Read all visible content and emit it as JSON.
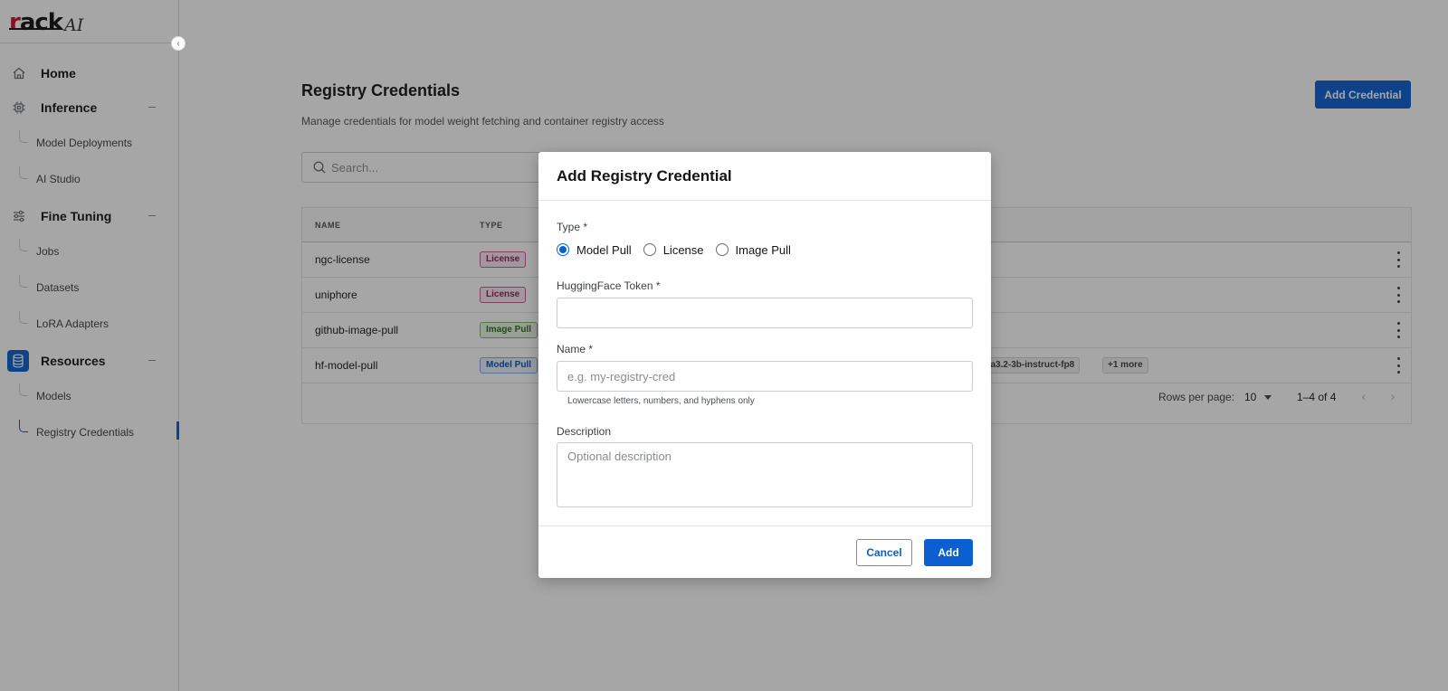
{
  "app": {
    "logo_r": "r",
    "logo_rack": "ack",
    "logo_ai": "AI"
  },
  "sidebar": {
    "home": {
      "label": "Home",
      "icon": "home-icon"
    },
    "inference": {
      "label": "Inference",
      "icon": "chip-icon",
      "items": [
        {
          "label": "Model Deployments"
        },
        {
          "label": "AI Studio"
        }
      ]
    },
    "fine_tuning": {
      "label": "Fine Tuning",
      "icon": "sliders-icon",
      "items": [
        {
          "label": "Jobs"
        },
        {
          "label": "Datasets"
        },
        {
          "label": "LoRA Adapters"
        }
      ]
    },
    "resources": {
      "label": "Resources",
      "icon": "database-icon",
      "items": [
        {
          "label": "Models"
        },
        {
          "label": "Registry Credentials",
          "active": true
        }
      ]
    }
  },
  "main": {
    "title": "Registry Credentials",
    "subtitle": "Manage credentials for model weight fetching and container registry access",
    "add_button": "Add Credential",
    "search_placeholder": "Search...",
    "columns": {
      "name": "NAME",
      "type": "TYPE"
    },
    "rows": [
      {
        "name": "ngc-license",
        "type": "License"
      },
      {
        "name": "uniphore",
        "type": "License"
      },
      {
        "name": "github-image-pull",
        "type": "Image Pull"
      },
      {
        "name": "hf-model-pull",
        "type": "Model Pull",
        "models": [
          "ama3.2-3b-instruct-fp8",
          "+1 more"
        ]
      }
    ],
    "pagination": {
      "rows_per_page_label": "Rows per page:",
      "rows_per_page": "10",
      "range": "1–4 of 4"
    }
  },
  "modal": {
    "title": "Add Registry Credential",
    "type_label": "Type *",
    "type_options": [
      "Model Pull",
      "License",
      "Image Pull"
    ],
    "selected_type": "Model Pull",
    "token_label": "HuggingFace Token *",
    "token_value": "",
    "name_label": "Name *",
    "name_placeholder": "e.g. my-registry-cred",
    "name_helper": "Lowercase letters, numbers, and hyphens only",
    "description_label": "Description",
    "description_placeholder": "Optional description",
    "cancel_label": "Cancel",
    "add_label": "Add"
  },
  "colors": {
    "primary": "#0b5fd1",
    "brand_red": "#c8102e",
    "license_badge": "#8b1d56",
    "image_pull_badge": "#2d6a1f",
    "model_pull_badge": "#0b4fb0"
  }
}
